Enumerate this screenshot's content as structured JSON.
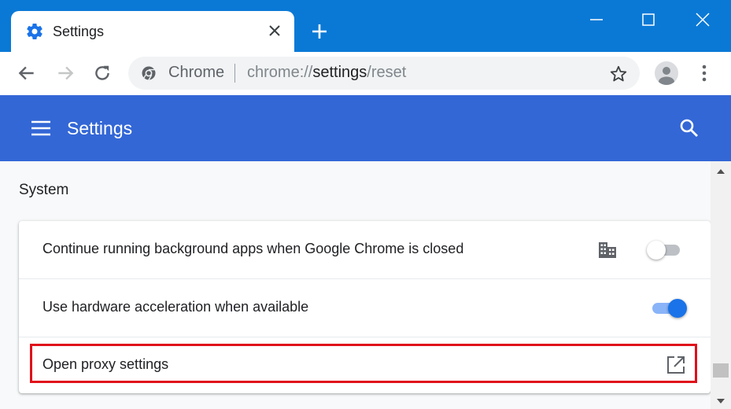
{
  "browser": {
    "tab_title": "Settings",
    "omnibox": {
      "host": "Chrome",
      "url_scheme": "chrome://",
      "url_host": "settings",
      "url_path": "/reset"
    },
    "icons": {
      "tab": "gear-icon",
      "tab_close": "close-icon",
      "new_tab": "plus-icon",
      "minimize": "minimize-icon",
      "maximize": "maximize-icon",
      "close_window": "close-window-icon",
      "back": "back-arrow-icon",
      "forward": "forward-arrow-icon",
      "reload": "reload-icon",
      "site_info": "chrome-logo-icon",
      "bookmark": "star-icon",
      "profile": "avatar-icon",
      "menu": "kebab-menu-icon"
    }
  },
  "settings_header": {
    "title": "Settings",
    "icons": {
      "menu": "hamburger-icon",
      "search": "search-icon"
    }
  },
  "section": {
    "title": "System",
    "rows": [
      {
        "label": "Continue running background apps when Google Chrome is closed",
        "control": "toggle",
        "enabled": false,
        "policy_icon": "enterprise-building-icon"
      },
      {
        "label": "Use hardware acceleration when available",
        "control": "toggle",
        "enabled": true
      },
      {
        "label": "Open proxy settings",
        "control": "external-link",
        "icon": "open-in-new-icon",
        "highlighted": true
      }
    ]
  },
  "colors": {
    "tabstrip": "#0a79d6",
    "header": "#3367d6",
    "toggle_on": "#1a73e8",
    "highlight": "#e0101a"
  }
}
